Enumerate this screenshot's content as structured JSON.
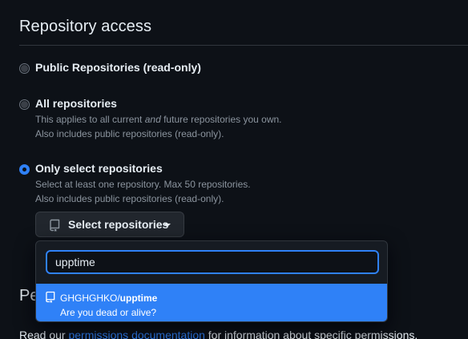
{
  "section": {
    "title": "Repository access"
  },
  "options": {
    "public": {
      "label": "Public Repositories (read-only)",
      "checked": false
    },
    "all": {
      "label": "All repositories",
      "note_line1_before": "This applies to all current ",
      "note_line1_em": "and",
      "note_line1_after": " future repositories you own.",
      "note_line2": "Also includes public repositories (read-only).",
      "checked": false
    },
    "select": {
      "label": "Only select repositories",
      "note_line1": "Select at least one repository. Max 50 repositories.",
      "note_line2": "Also includes public repositories (read-only).",
      "checked": true
    }
  },
  "select_button": {
    "label": "Select repositories",
    "icon": "repo-icon"
  },
  "dropdown": {
    "search_value": "upptime",
    "results": [
      {
        "owner": "GHGHGHKO/",
        "name": "upptime",
        "description": "Are you dead or alive?",
        "icon": "repo-icon",
        "highlighted": true
      }
    ]
  },
  "behind": {
    "heading_fragment": "Pe",
    "permissions_text_before": "Read our ",
    "permissions_link": "permissions documentation",
    "permissions_text_after": " for information about specific permissions."
  },
  "colors": {
    "background": "#0d1117",
    "accent": "#2f81f7",
    "muted_text": "#8b949e",
    "border": "#30363d"
  }
}
